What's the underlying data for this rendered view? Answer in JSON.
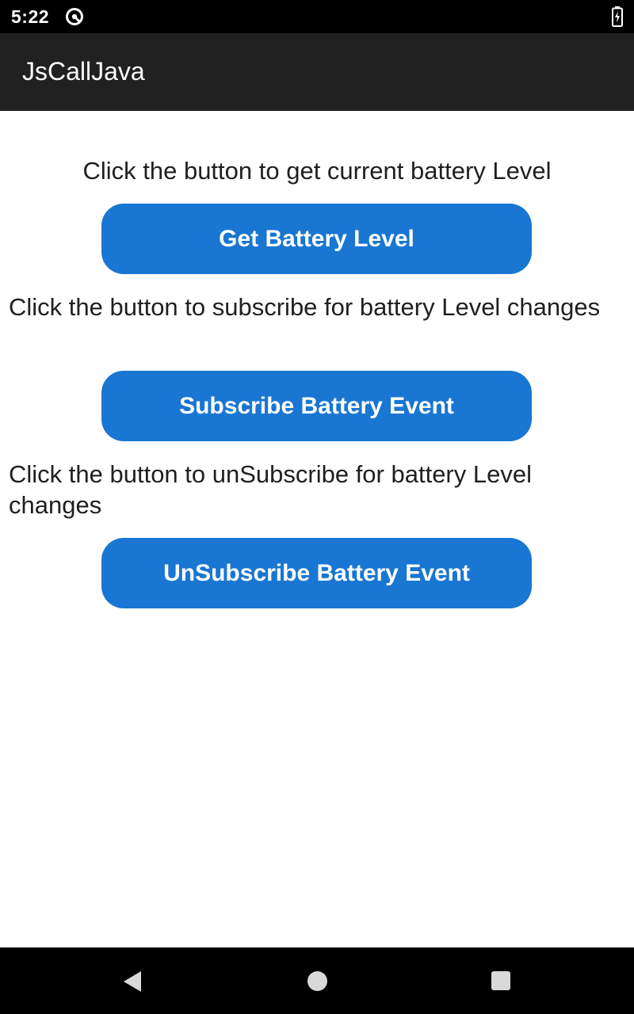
{
  "status_bar": {
    "time": "5:22",
    "icons": [
      "do-not-disturb-icon",
      "battery-charging-icon"
    ]
  },
  "app_bar": {
    "title": "JsCallJava"
  },
  "sections": {
    "get_level": {
      "prompt": "Click the button to get current battery Level",
      "button_label": "Get Battery Level"
    },
    "subscribe": {
      "prompt": "Click the button to subscribe for battery Level changes",
      "button_label": "Subscribe Battery Event"
    },
    "unsubscribe": {
      "prompt": "Click the button to unSubscribe for battery Level changes",
      "button_label": "UnSubscribe Battery Event"
    }
  },
  "nav_bar": {
    "icons": [
      "back-icon",
      "home-icon",
      "recents-icon"
    ]
  },
  "colors": {
    "button_background": "#1976d2",
    "app_bar_background": "#212121",
    "status_bar_background": "#000000"
  }
}
